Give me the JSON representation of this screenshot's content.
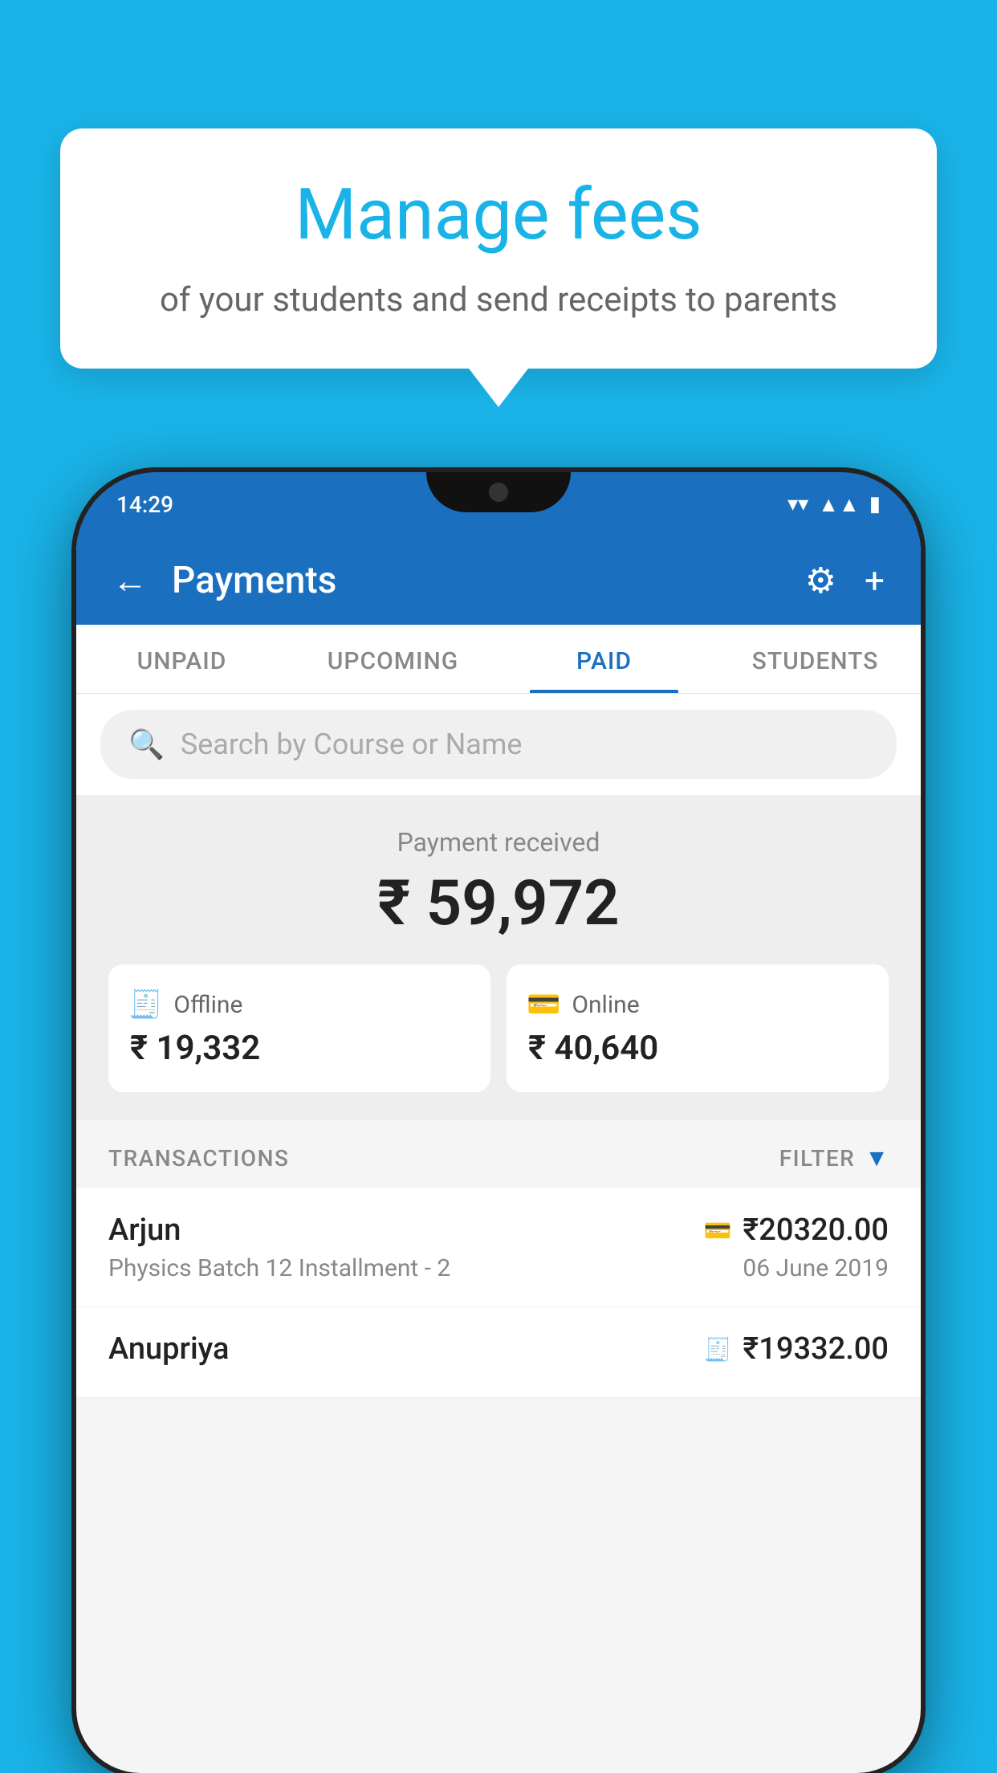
{
  "background_color": "#1ab3e8",
  "tooltip": {
    "title": "Manage fees",
    "subtitle": "of your students and send receipts to parents"
  },
  "status_bar": {
    "time": "14:29",
    "icons": [
      "wifi",
      "signal",
      "battery"
    ]
  },
  "header": {
    "title": "Payments",
    "back_label": "←",
    "gear_label": "⚙",
    "plus_label": "+"
  },
  "tabs": [
    {
      "label": "UNPAID",
      "active": false
    },
    {
      "label": "UPCOMING",
      "active": false
    },
    {
      "label": "PAID",
      "active": true
    },
    {
      "label": "STUDENTS",
      "active": false
    }
  ],
  "search": {
    "placeholder": "Search by Course or Name"
  },
  "payment_summary": {
    "label": "Payment received",
    "amount": "₹ 59,972",
    "offline": {
      "icon": "💳",
      "label": "Offline",
      "amount": "₹ 19,332"
    },
    "online": {
      "icon": "💳",
      "label": "Online",
      "amount": "₹ 40,640"
    }
  },
  "transactions": {
    "label": "TRANSACTIONS",
    "filter_label": "FILTER",
    "items": [
      {
        "name": "Arjun",
        "amount": "₹20320.00",
        "type_icon": "card",
        "course": "Physics Batch 12 Installment - 2",
        "date": "06 June 2019"
      },
      {
        "name": "Anupriya",
        "amount": "₹19332.00",
        "type_icon": "cash",
        "course": "",
        "date": ""
      }
    ]
  }
}
